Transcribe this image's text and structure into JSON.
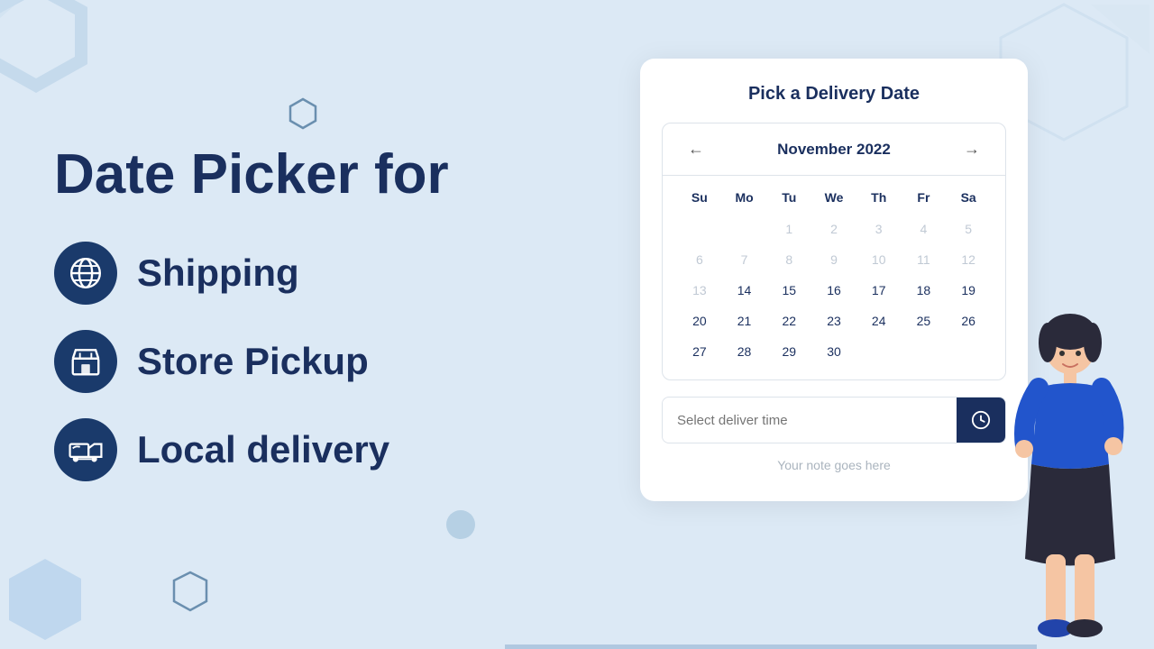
{
  "background": {
    "color": "#dce9f5"
  },
  "left": {
    "title": "Date Picker for",
    "features": [
      {
        "id": "shipping",
        "label": "Shipping",
        "icon": "globe"
      },
      {
        "id": "store-pickup",
        "label": "Store Pickup",
        "icon": "store"
      },
      {
        "id": "local-delivery",
        "label": "Local delivery",
        "icon": "delivery"
      }
    ]
  },
  "calendar_card": {
    "title": "Pick a Delivery Date",
    "month": "November 2022",
    "weekdays": [
      "Su",
      "Mo",
      "Tu",
      "We",
      "Th",
      "Fr",
      "Sa"
    ],
    "rows": [
      [
        "",
        "",
        "1",
        "2",
        "3",
        "4",
        "5"
      ],
      [
        "6",
        "7",
        "8",
        "9",
        "10",
        "11",
        "12"
      ],
      [
        "13",
        "14",
        "15",
        "16",
        "17",
        "18",
        "19"
      ],
      [
        "20",
        "21",
        "22",
        "23",
        "24",
        "25",
        "26"
      ],
      [
        "27",
        "28",
        "29",
        "30",
        "",
        "",
        ""
      ]
    ],
    "disabled_days": [
      "6",
      "7",
      "8",
      "9",
      "10",
      "11",
      "12",
      "13",
      "1",
      "2",
      "3",
      "4",
      "5"
    ],
    "time_picker": {
      "placeholder": "Select deliver time",
      "button_icon": "clock"
    },
    "note": "Your note goes here"
  }
}
